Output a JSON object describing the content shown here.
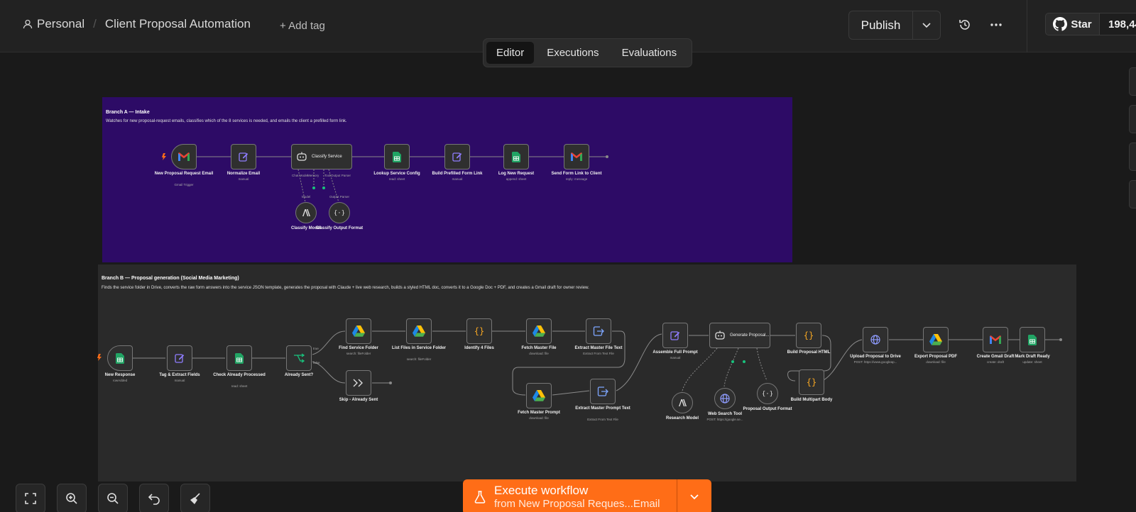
{
  "header": {
    "project": "Personal",
    "workflow_name": "Client Proposal Automation",
    "add_tag": "+ Add tag",
    "publish": "Publish",
    "github_star": "Star",
    "github_count": "198,44"
  },
  "tabs": [
    "Editor",
    "Executions",
    "Evaluations"
  ],
  "branch_a": {
    "title": "Branch A — Intake",
    "desc": "Watches for new proposal-request emails, classifies which of the 8 services is needed, and emails the client a prefilled form link.",
    "nodes": [
      {
        "label": "New Proposal Request Email",
        "sub": "Gmail Trigger"
      },
      {
        "label": "Normalize Email",
        "sub": "manual"
      },
      {
        "label": "Classify Service",
        "sub": ""
      },
      {
        "label": "Lookup Service Config",
        "sub": "read: sheet"
      },
      {
        "label": "Build Prefilled Form Link",
        "sub": "manual"
      },
      {
        "label": "Log New Request",
        "sub": "append: sheet"
      },
      {
        "label": "Send Form Link to Client",
        "sub": "reply: message"
      }
    ],
    "sub_nodes": [
      {
        "label": "Classify Model"
      },
      {
        "label": "Classify Output Format"
      }
    ],
    "ports": {
      "chat_model": "Chat Model",
      "memory": "Memory",
      "tool": "Tool",
      "output_parser": "Output Parser",
      "model": "Model"
    }
  },
  "branch_b": {
    "title": "Branch B — Proposal generation (Social Media Marketing)",
    "desc": "Finds the service folder in Drive, converts the raw form answers into the service JSON template, generates the proposal with Claude + live web research, builds a styled HTML doc, converts it to a Google Doc + PDF, and creates a Gmail draft for owner review.",
    "nodes": [
      {
        "label": "New Response",
        "sub": "rowAdded"
      },
      {
        "label": "Tag & Extract Fields",
        "sub": "manual"
      },
      {
        "label": "Check Already Processed",
        "sub": "read: sheet"
      },
      {
        "label": "Already Sent?",
        "sub": ""
      },
      {
        "label": "Find Service Folder",
        "sub": "search: fileFolder"
      },
      {
        "label": "Skip - Already Sent",
        "sub": ""
      },
      {
        "label": "List Files in Service Folder",
        "sub": "search: fileFolder"
      },
      {
        "label": "Identify 4 Files",
        "sub": ""
      },
      {
        "label": "Fetch Master File",
        "sub": "download: file"
      },
      {
        "label": "Extract Master File Text",
        "sub": "Extract From Text File"
      },
      {
        "label": "Fetch Master Prompt",
        "sub": "download: file"
      },
      {
        "label": "Extract Master Prompt Text",
        "sub": "Extract From Text File"
      },
      {
        "label": "Assemble Full Prompt",
        "sub": "manual"
      },
      {
        "label": "Generate Proposal...",
        "sub": ""
      },
      {
        "label": "Build Proposal HTML",
        "sub": ""
      },
      {
        "label": "Build Multipart Body",
        "sub": ""
      },
      {
        "label": "Upload Proposal to Drive",
        "sub": "POST: https://www.googleap..."
      },
      {
        "label": "Export Proposal PDF",
        "sub": "download: file"
      },
      {
        "label": "Create Gmail Draft",
        "sub": "create: draft"
      },
      {
        "label": "Mark Draft Ready",
        "sub": "update: sheet"
      }
    ],
    "sub_nodes": [
      {
        "label": "Research Model",
        "sub": ""
      },
      {
        "label": "Web Search Tool",
        "sub": "POST: https://google.se..."
      },
      {
        "label": "Proposal Output Format",
        "sub": ""
      }
    ],
    "if_true": "true",
    "if_false": "false"
  },
  "execute": {
    "title": "Execute workflow",
    "subtitle": "from New Proposal Reques...Email"
  },
  "colors": {
    "accent": "#ff6d17",
    "branch_a_bg": "#2d0b66",
    "sheets_green": "#21a464",
    "code_orange": "#f5a623",
    "edit_purple": "#8f7dff"
  }
}
